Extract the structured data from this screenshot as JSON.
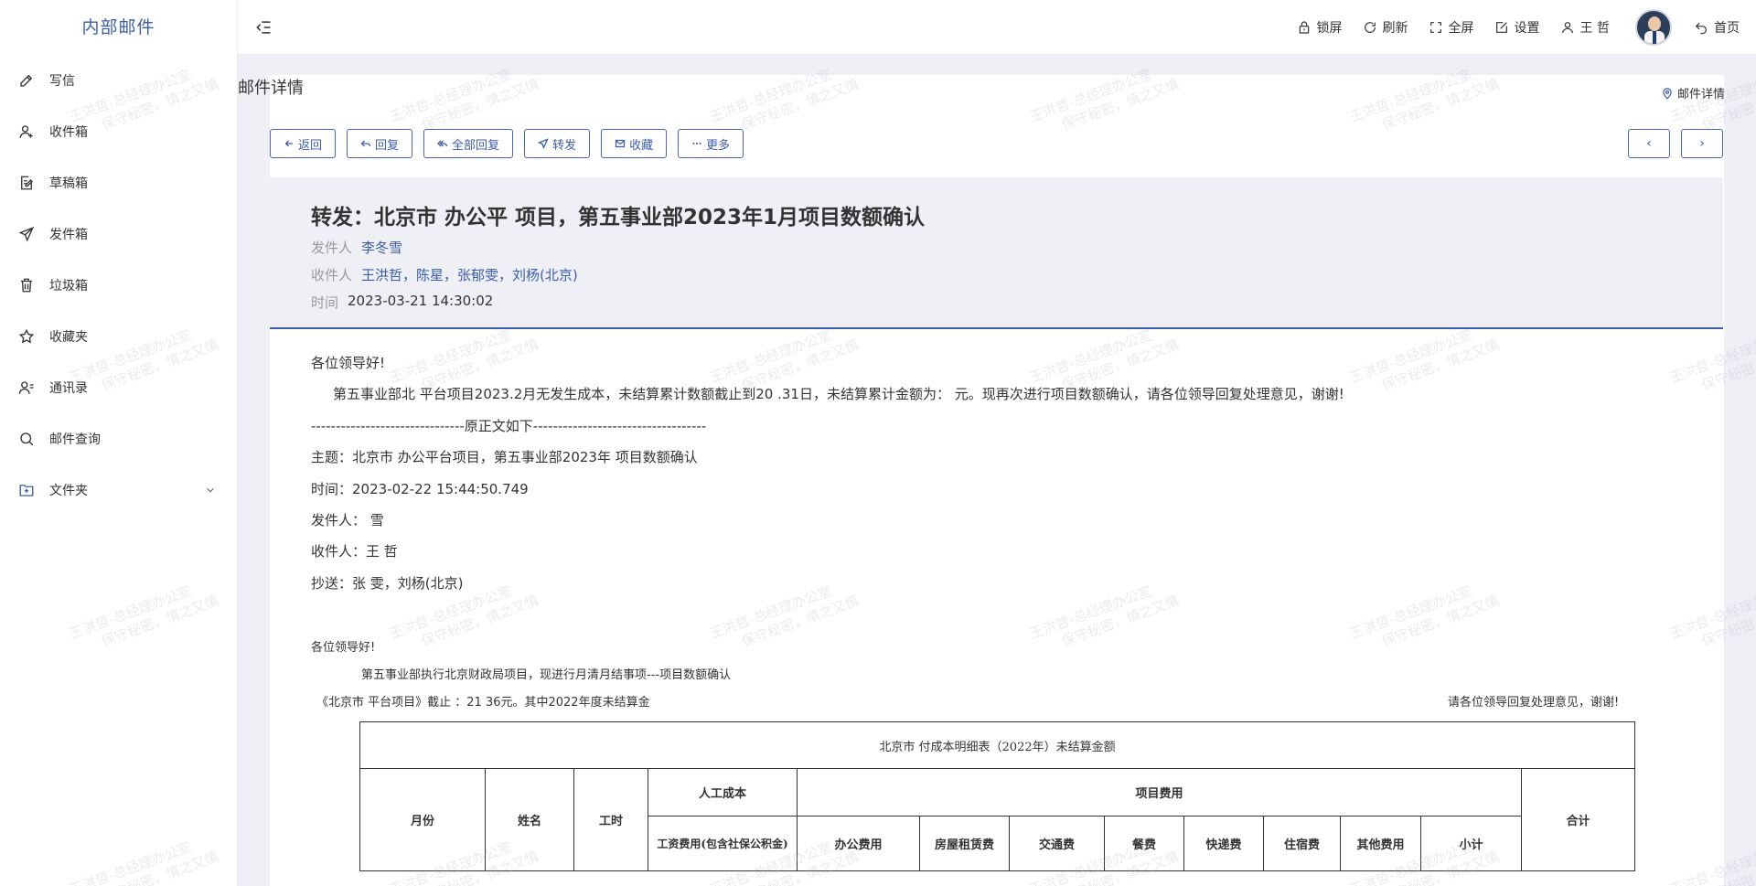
{
  "app": {
    "logo": "内部邮件"
  },
  "sidebar": {
    "items": [
      {
        "label": "写信",
        "icon": "pencil-icon"
      },
      {
        "label": "收件箱",
        "icon": "user-plus-icon"
      },
      {
        "label": "草稿箱",
        "icon": "note-edit-icon"
      },
      {
        "label": "发件箱",
        "icon": "send-icon"
      },
      {
        "label": "垃圾箱",
        "icon": "trash-icon"
      },
      {
        "label": "收藏夹",
        "icon": "star-icon"
      },
      {
        "label": "通讯录",
        "icon": "contacts-icon"
      },
      {
        "label": "邮件查询",
        "icon": "search-icon"
      },
      {
        "label": "文件夹",
        "icon": "folder-plus-icon"
      }
    ]
  },
  "header": {
    "lock": "锁屏",
    "refresh": "刷新",
    "fullscreen": "全屏",
    "settings": "设置",
    "user": "王 哲",
    "home": "首页"
  },
  "page": {
    "title": "邮件详情",
    "location": "邮件详情"
  },
  "toolbar": {
    "back": "返回",
    "reply": "回复",
    "reply_all": "全部回复",
    "forward": "转发",
    "favorite": "收藏",
    "more": "更多",
    "prev": "‹",
    "next": "›"
  },
  "mail": {
    "subject": "转发：北京市                        办公平  项目，第五事业部2023年1月项目数额确认",
    "sender_label": "发件人",
    "sender": "李冬雪",
    "recipients_label": "收件人",
    "recipients": "王洪哲，陈星，张郁雯，刘杨(北京)",
    "time_label": "时间",
    "time": "2023-03-21 14:30:02"
  },
  "body": {
    "greeting": "各位领导好!",
    "para1": "第五事业部北                              平台项目2023.2月无发生成本，未结算累计数额截止到20   .31日，未结算累计金额为：            元。现再次进行项目数额确认，请各位领导回复处理意见，谢谢!",
    "divider": "-------------------------------原正文如下-----------------------------------",
    "orig_subject": "主题：北京市                      办公平台项目，第五事业部2023年  项目数额确认",
    "orig_time": "时间：2023-02-22 15:44:50.749",
    "orig_sender": "发件人：     雪",
    "orig_recipient": "收件人：王  哲",
    "orig_cc": "抄送：张  雯，刘杨(北京)",
    "greeting2": "各位领导好!",
    "para2": "第五事业部执行北京财政局项目，现进行月清月结事项---项目数额确认",
    "para3_left": "《北京市                          平台项目》截止                                          ：21      36元。其中2022年度未结算金",
    "para3_right": "请各位领导回复处理意见，谢谢!"
  },
  "table": {
    "title": "北京市                                            付成本明细表（2022年）未结算金额",
    "month": "月份",
    "name": "姓名",
    "hours": "工时",
    "labor": "人工成本",
    "project": "项目费用",
    "total": "合计",
    "wage": "工资费用(包含社保公积金)",
    "office": "办公费用",
    "rent": "房屋租赁费",
    "transport": "交通费",
    "meal": "餐费",
    "express": "快递费",
    "hotel": "住宿费",
    "other": "其他费用",
    "subtotal": "小计"
  },
  "watermark": {
    "line1": "王洪哲-总经理办公室",
    "line2": "保守秘密，慎之又慎"
  },
  "colors": {
    "accent": "#3d5ca8",
    "background": "#eef0f5"
  }
}
